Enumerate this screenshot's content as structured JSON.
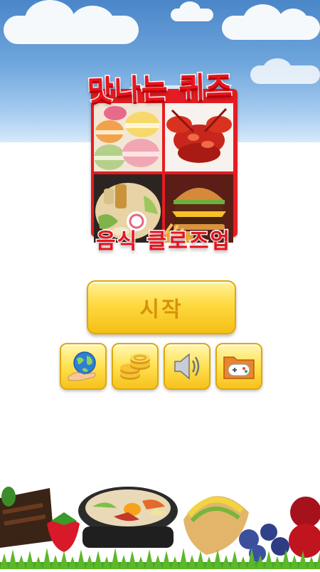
{
  "title": {
    "line1": "맛나는 퀴즈",
    "line2": "음식 클로즈업"
  },
  "start_button": {
    "label": "시작"
  },
  "icon_buttons": [
    {
      "icon": "globe-hand-icon"
    },
    {
      "icon": "coins-icon"
    },
    {
      "icon": "speaker-icon"
    },
    {
      "icon": "folder-gamepad-icon"
    }
  ],
  "logo_images": [
    "macarons",
    "lobster",
    "ramen",
    "hamburger"
  ],
  "colors": {
    "title_red": "#e8141e",
    "button_yellow": "#ffd940",
    "button_text": "#d6920b",
    "sky": "#6fa6dc",
    "grass": "#5cb82a"
  }
}
